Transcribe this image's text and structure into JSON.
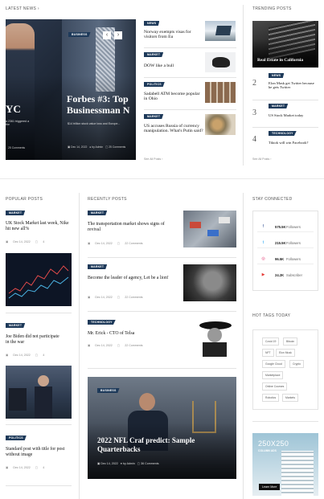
{
  "sections": {
    "latest_news": "LATEST NEWS",
    "trending_posts": "TRENDING POSTS",
    "popular_posts": "POPULAR POSTS",
    "recently_posts": "RECENTLY POSTS",
    "stay_connected": "STAY CONNECTED",
    "hot_tags": "HOT TAGS TODAY"
  },
  "hero": {
    "badge": "BUSINESS",
    "title_line1": "Forbes #3: Top",
    "title_line2": "Businessman N",
    "left_title_fragment": "YC",
    "left_excerpt_1": "a 2361 triggered a",
    "left_excerpt_2": "the",
    "left_comments": "25 Comments",
    "excerpt": "$14 trillion stock value loss and Europe...",
    "date": "Dec 14, 2022",
    "author": "by Admin",
    "comments": "25 Comments"
  },
  "latest_list": [
    {
      "badge": "NEWS",
      "title": "Norway exempts visas for visitors from Eu"
    },
    {
      "badge": "MARKET",
      "title": "DOW like a bull"
    },
    {
      "badge": "POLITICS",
      "title": "Sadabell ATM become popular in Ohio"
    },
    {
      "badge": "MARKET",
      "title": "US accuses Russia of currency manipulation. What's Putin said?"
    }
  ],
  "latest_see_all": "See All Posts",
  "trending": {
    "feature_title": "Real Estate in California",
    "items": [
      {
        "num": "2",
        "badge": "NEWS",
        "title": "Elon Mask get Twitter because he gets Twitter"
      },
      {
        "num": "3",
        "badge": "MARKET",
        "title": "US Stock Market today"
      },
      {
        "num": "4",
        "badge": "TECHNOLOGY",
        "title": "Tiktok will win Facebook?"
      }
    ],
    "see_all": "See All Posts"
  },
  "popular": [
    {
      "badge": "MARKET",
      "title": "UK Stock Market last week, Nike hit new all%",
      "date": "Dec 14, 2022",
      "comments": "4"
    },
    {
      "badge": "MARKET",
      "title": "Joe Biden did not participate in the war",
      "date": "Dec 14, 2022",
      "comments": "4"
    },
    {
      "badge": "POLITICS",
      "title": "Standard post with title for post without image",
      "date": "Dec 14, 2022",
      "comments": "4"
    }
  ],
  "recent": [
    {
      "badge": "MARKET",
      "title": "The transportation market shows signs of revival",
      "date": "Dec 14, 2022",
      "comments": "22 Comments"
    },
    {
      "badge": "MARKET",
      "title": "Become the leader of agency, Let be a lion!",
      "date": "Dec 14, 2022",
      "comments": "22 Comments"
    },
    {
      "badge": "TECHNOLOGY",
      "title": "Mr. Erick - CTO of Telsa",
      "date": "Dec 14, 2022",
      "comments": "22 Comments"
    }
  ],
  "recent_feature": {
    "badge": "BUSINESS",
    "title": "2022 NFL Craf predict: Sample Quarterbacks",
    "date": "Dec 14, 2022",
    "author": "by Admin",
    "comments": "36 Comments"
  },
  "social": [
    {
      "icon": "f",
      "count": "575.5K",
      "label": "Followers",
      "color": "#3b5998"
    },
    {
      "icon": "t",
      "count": "215.5K",
      "label": "Followers",
      "color": "#1da1f2"
    },
    {
      "icon": "◎",
      "count": "96.5K",
      "label": "Followers",
      "color": "#e1306c"
    },
    {
      "icon": "▶",
      "count": "24.2K",
      "label": "Subscriber",
      "color": "#e53935"
    }
  ],
  "tags": [
    "Covid 19",
    "Bitcoin",
    "NFT",
    "Elon Musk",
    "Google Cloud",
    "Crypto",
    "Marketplace",
    "Online Courses",
    "Robotics",
    "Markets"
  ],
  "ad": {
    "size": "250X250",
    "sub": "COLUMN ADS",
    "button": "Learn More"
  }
}
